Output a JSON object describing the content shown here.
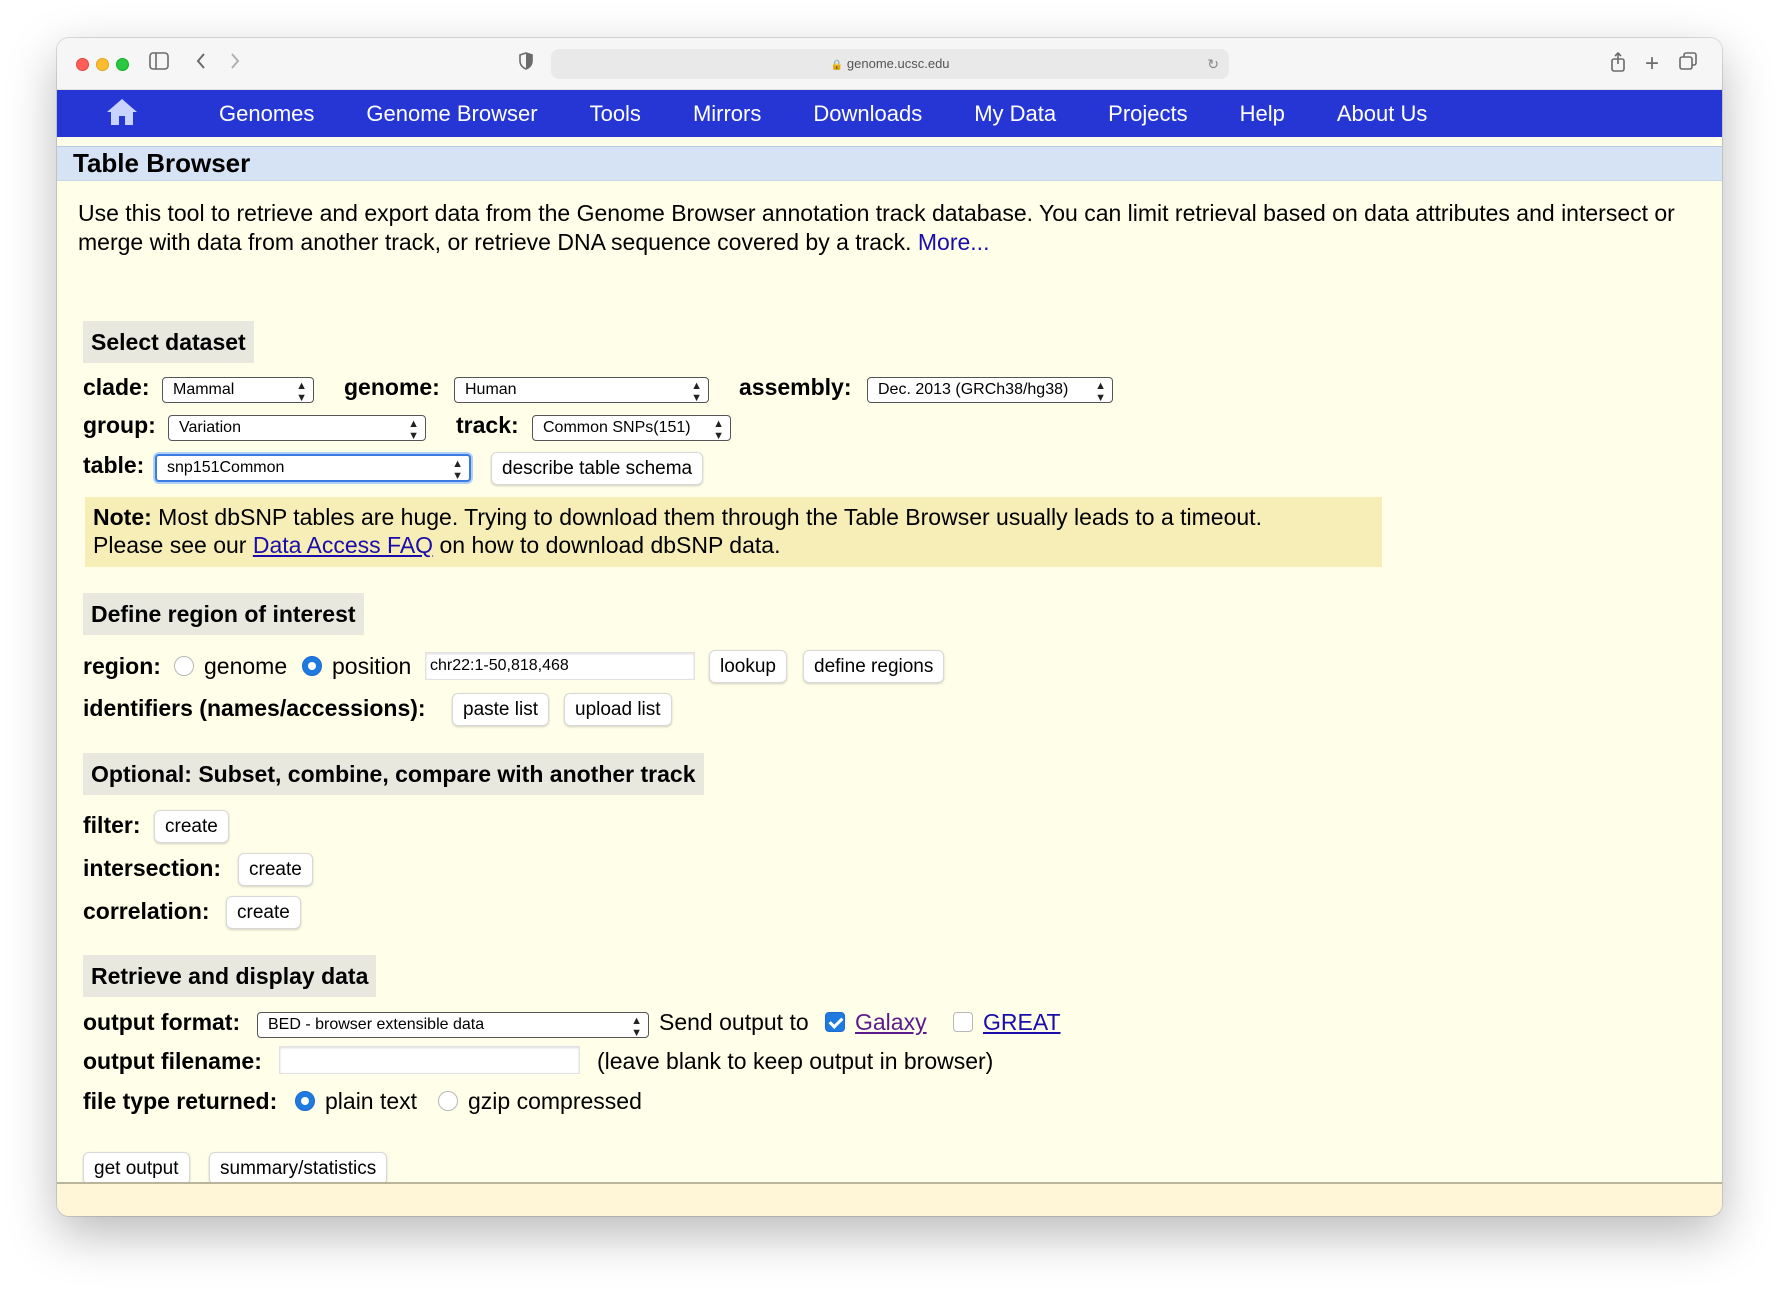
{
  "browser": {
    "url": "genome.ucsc.edu"
  },
  "nav": {
    "items": [
      "Genomes",
      "Genome Browser",
      "Tools",
      "Mirrors",
      "Downloads",
      "My Data",
      "Projects",
      "Help",
      "About Us"
    ]
  },
  "page": {
    "title": "Table Browser",
    "intro": "Use this tool to retrieve and export data from the Genome Browser annotation track database. You can limit retrieval based on data attributes and intersect or merge with data from another track, or retrieve DNA sequence covered by a track.",
    "more_link": "More..."
  },
  "dataset": {
    "heading": "Select dataset",
    "clade_label": "clade:",
    "clade_value": "Mammal",
    "genome_label": "genome:",
    "genome_value": "Human",
    "assembly_label": "assembly:",
    "assembly_value": "Dec. 2013 (GRCh38/hg38)",
    "group_label": "group:",
    "group_value": "Variation",
    "track_label": "track:",
    "track_value": "Common SNPs(151)",
    "table_label": "table:",
    "table_value": "snp151Common",
    "schema_button": "describe table schema"
  },
  "note": {
    "bold": "Note:",
    "text1": "Most dbSNP tables are huge. Trying to download them through the Table Browser usually leads to a timeout.",
    "text2_pre": "Please see our",
    "link": "Data Access FAQ",
    "text2_post": "on how to download dbSNP data."
  },
  "region": {
    "heading": "Define region of interest",
    "label": "region:",
    "option_genome": "genome",
    "option_position": "position",
    "position_value": "chr22:1-50,818,468",
    "lookup_button": "lookup",
    "define_button": "define regions",
    "identifiers_label": "identifiers (names/accessions):",
    "paste_button": "paste list",
    "upload_button": "upload list"
  },
  "optional": {
    "heading": "Optional: Subset, combine, compare with another track",
    "filter_label": "filter:",
    "intersection_label": "intersection:",
    "correlation_label": "correlation:",
    "create_button": "create"
  },
  "retrieve": {
    "heading": "Retrieve and display data",
    "format_label": "output format:",
    "format_value": "BED - browser extensible data",
    "send_label": "Send output to",
    "galaxy": "Galaxy",
    "great": "GREAT",
    "filename_label": "output filename:",
    "filename_value": "",
    "filename_hint": "(leave blank to keep output in browser)",
    "filetype_label": "file type returned:",
    "plain_text": "plain text",
    "gzip": "gzip compressed",
    "get_output_button": "get output",
    "summary_button": "summary/statistics"
  },
  "colors": {
    "nav": "#2636d4",
    "page_bg": "#fffee8",
    "title_bar": "#d6e3f5",
    "note_bg": "#f6eeb6"
  }
}
